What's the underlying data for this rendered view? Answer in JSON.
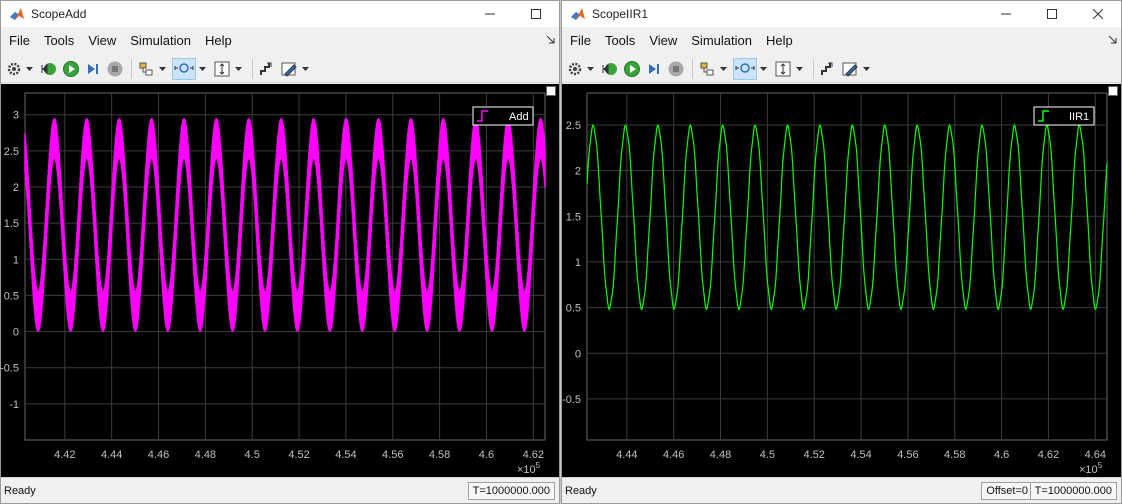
{
  "windows": [
    {
      "title": "ScopeAdd",
      "menus": [
        "File",
        "Tools",
        "View",
        "Simulation",
        "Help"
      ],
      "status": "Ready",
      "status_time": "T=1000000.000",
      "legend": {
        "label": "Add",
        "color": "#ff00ff"
      }
    },
    {
      "title": "ScopeIIR1",
      "menus": [
        "File",
        "Tools",
        "View",
        "Simulation",
        "Help"
      ],
      "status": "Ready",
      "status_offset": "Offset=0",
      "status_time": "T=1000000.000",
      "legend": {
        "label": "IIR1",
        "color": "#00ff00"
      }
    }
  ],
  "chart_data": [
    {
      "type": "line",
      "title": "",
      "xlabel": "",
      "ylabel": "",
      "x_multiplier_label": "×10^5",
      "xlim": [
        4.403,
        4.625
      ],
      "ylim": [
        -1.5,
        3.3
      ],
      "xticks": [
        "4.42",
        "4.44",
        "4.46",
        "4.48",
        "4.5",
        "4.52",
        "4.54",
        "4.56",
        "4.58",
        "4.6",
        "4.62"
      ],
      "yticks": [
        "-1",
        "-0.5",
        "0",
        "0.5",
        "1",
        "1.5",
        "2",
        "2.5",
        "3"
      ],
      "grid": true,
      "legend_position": "top-right",
      "series": [
        {
          "name": "Add",
          "color": "#ff00ff",
          "description_values": {
            "period_x": 0.01384,
            "min": 0.0,
            "max": 2.95,
            "noise_band": 0.55
          }
        }
      ]
    },
    {
      "type": "line",
      "title": "",
      "xlabel": "",
      "ylabel": "",
      "x_multiplier_label": "×10^5",
      "xlim": [
        4.423,
        4.645
      ],
      "ylim": [
        -0.95,
        2.85
      ],
      "xticks": [
        "4.44",
        "4.46",
        "4.48",
        "4.5",
        "4.52",
        "4.54",
        "4.56",
        "4.58",
        "4.6",
        "4.62",
        "4.64"
      ],
      "yticks": [
        "-0.5",
        "0",
        "0.5",
        "1",
        "1.5",
        "2",
        "2.5"
      ],
      "grid": true,
      "legend_position": "top-right",
      "series": [
        {
          "name": "IIR1",
          "color": "#00ff00",
          "description_values": {
            "period_x": 0.01384,
            "min": 0.5,
            "max": 2.48
          }
        }
      ]
    }
  ]
}
